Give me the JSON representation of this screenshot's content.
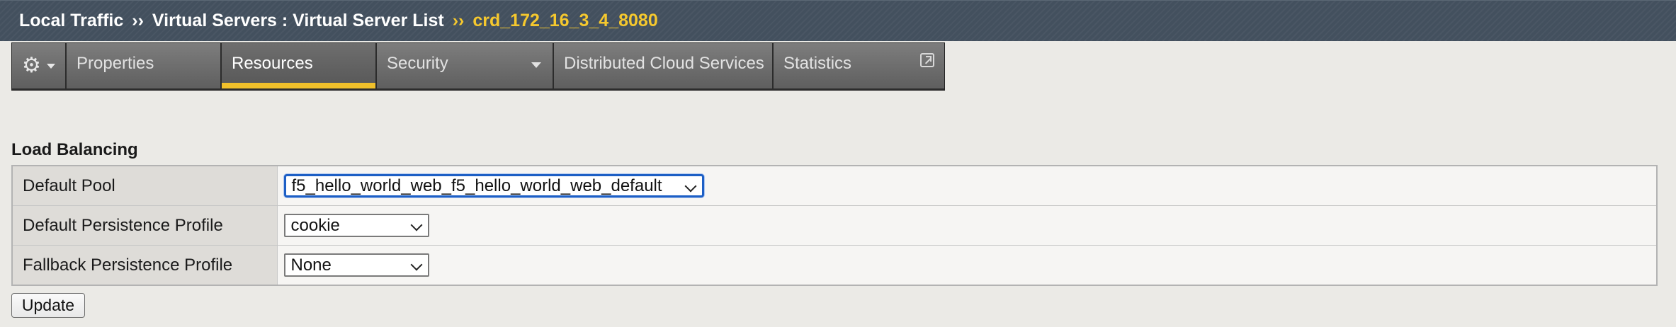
{
  "breadcrumb": {
    "items": [
      "Local Traffic",
      "Virtual Servers : Virtual Server List"
    ],
    "separator": "››",
    "current": "crd_172_16_3_4_8080"
  },
  "tabs": {
    "settings_icon": "gear-icon",
    "items": [
      {
        "label": "Properties",
        "active": false
      },
      {
        "label": "Resources",
        "active": true
      },
      {
        "label": "Security",
        "active": false,
        "dropdown": true
      },
      {
        "label": "Distributed Cloud Services",
        "active": false
      },
      {
        "label": "Statistics",
        "active": false,
        "icon": "external-link-icon"
      }
    ]
  },
  "load_balancing": {
    "title": "Load Balancing",
    "rows": [
      {
        "label": "Default Pool",
        "value": "f5_hello_world_web_f5_hello_world_web_default"
      },
      {
        "label": "Default Persistence Profile",
        "value": "cookie"
      },
      {
        "label": "Fallback Persistence Profile",
        "value": "None"
      }
    ]
  },
  "actions": {
    "update_label": "Update"
  },
  "colors": {
    "header_bg": "#43505e",
    "accent": "#f0c02b",
    "focus": "#1d5fc5"
  }
}
